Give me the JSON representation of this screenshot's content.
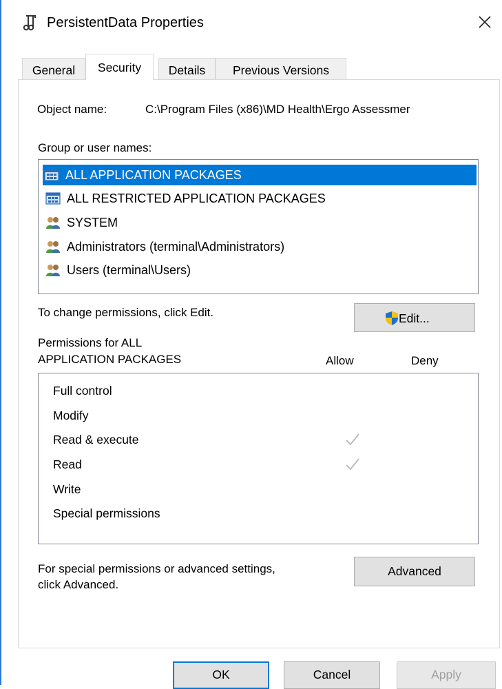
{
  "window": {
    "title": "PersistentData Properties"
  },
  "tabs": [
    {
      "label": "General"
    },
    {
      "label": "Security"
    },
    {
      "label": "Details"
    },
    {
      "label": "Previous Versions"
    }
  ],
  "security": {
    "object_name_label": "Object name:",
    "object_name_value": "C:\\Program Files (x86)\\MD Health\\Ergo Assessmer",
    "group_label": "Group or user names:",
    "principals": [
      {
        "name": "ALL APPLICATION PACKAGES",
        "icon": "app-packages-icon",
        "selected": true
      },
      {
        "name": "ALL RESTRICTED APPLICATION PACKAGES",
        "icon": "app-packages-icon",
        "selected": false
      },
      {
        "name": "SYSTEM",
        "icon": "users-icon",
        "selected": false
      },
      {
        "name": "Administrators (terminal\\Administrators)",
        "icon": "users-icon",
        "selected": false
      },
      {
        "name": "Users (terminal\\Users)",
        "icon": "users-icon",
        "selected": false
      }
    ],
    "change_hint": "To change permissions, click Edit.",
    "edit_label": "Edit...",
    "permissions_for_line1": "Permissions for ALL",
    "permissions_for_line2": "APPLICATION PACKAGES",
    "allow_header": "Allow",
    "deny_header": "Deny",
    "permissions": [
      {
        "name": "Full control",
        "allow": false,
        "deny": false
      },
      {
        "name": "Modify",
        "allow": false,
        "deny": false
      },
      {
        "name": "Read & execute",
        "allow": true,
        "deny": false
      },
      {
        "name": "Read",
        "allow": true,
        "deny": false
      },
      {
        "name": "Write",
        "allow": false,
        "deny": false
      },
      {
        "name": "Special permissions",
        "allow": false,
        "deny": false
      }
    ],
    "advanced_hint_line1": "For special permissions or advanced settings,",
    "advanced_hint_line2": "click Advanced.",
    "advanced_label": "Advanced"
  },
  "footer": {
    "ok_label": "OK",
    "cancel_label": "Cancel",
    "apply_label": "Apply"
  },
  "colors": {
    "accent": "#0078d7",
    "selection": "#0078d7",
    "check_disabled": "#bcbcbc"
  }
}
